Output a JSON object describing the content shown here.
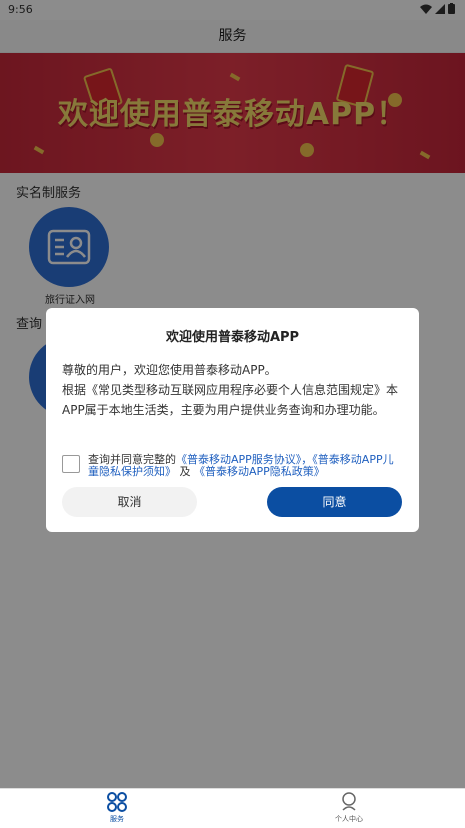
{
  "status_bar": {
    "time": "9:56"
  },
  "header": {
    "title": "服务"
  },
  "banner": {
    "text": "欢迎使用普泰移动APP！"
  },
  "sections": [
    {
      "title": "实名制服务",
      "items": [
        {
          "label": "旅行证入网",
          "icon": "id-card-icon"
        }
      ]
    },
    {
      "title": "查询"
    }
  ],
  "dialog": {
    "title": "欢迎使用普泰移动APP",
    "body_line1": "尊敬的用户，欢迎您使用普泰移动APP。",
    "body_line2": "根据《常见类型移动互联网应用程序必要个人信息范围规定》本APP属于本地生活类，主要为用户提供业务查询和办理功能。",
    "agree_prefix": "查询并同意完整的",
    "link1": "《普泰移动APP服务协议》，《普泰移动APP儿童隐私保护须知》",
    "agree_join": "及",
    "link2": "《普泰移动APP隐私政策》",
    "cancel_label": "取消",
    "agree_label": "同意"
  },
  "tabbar": {
    "items": [
      {
        "label": "服务",
        "icon": "grid-icon"
      },
      {
        "label": "个人中心",
        "icon": "person-icon"
      }
    ]
  },
  "colors": {
    "primary": "#0b4ea2",
    "service_circle": "#2f6fd6",
    "banner_red": "#d4303f",
    "banner_text": "#f6dc6b"
  }
}
